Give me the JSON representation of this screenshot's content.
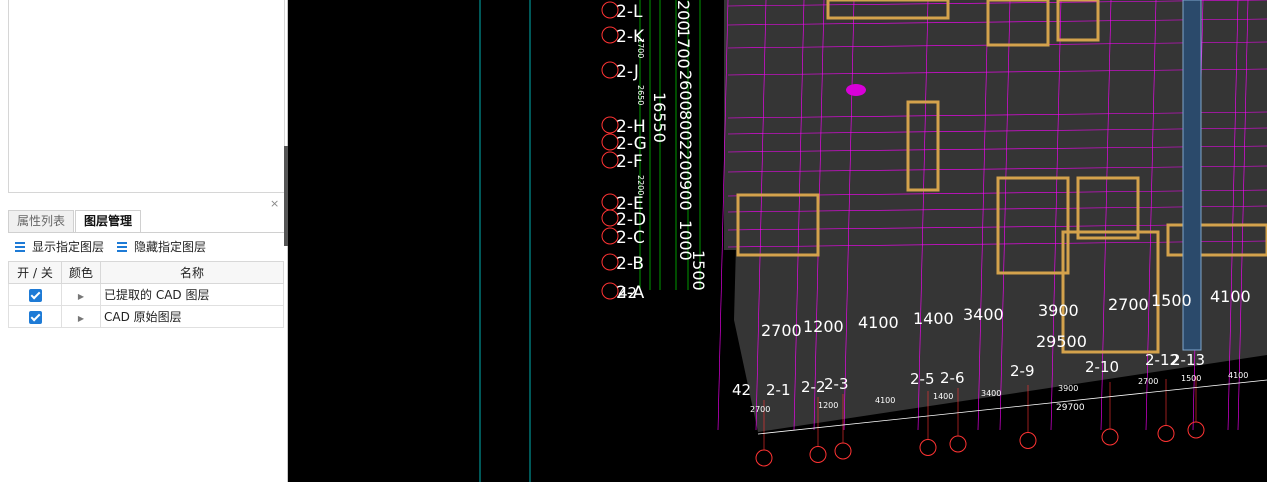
{
  "panel": {
    "close": "×",
    "tabs": [
      {
        "label": "属性列表",
        "active": false
      },
      {
        "label": "图层管理",
        "active": true
      }
    ],
    "toolbar": {
      "show_layer": "显示指定图层",
      "hide_layer": "隐藏指定图层"
    },
    "table": {
      "headers": [
        "开 / 关",
        "颜色",
        "名称"
      ],
      "rows": [
        {
          "checked": true,
          "name": "已提取的 CAD 图层"
        },
        {
          "checked": true,
          "name": "CAD 原始图层"
        }
      ]
    }
  },
  "drawing": {
    "axes_left": [
      "2-L",
      "2-K",
      "2-J",
      "2-H",
      "2-G",
      "2-F",
      "2-E",
      "2-D",
      "2-C",
      "2-B",
      "2-A"
    ],
    "axis_prefix": "42",
    "left_dims_big": [
      "200",
      "1700",
      "2600",
      "800",
      "2200",
      "900",
      "1000",
      "1500"
    ],
    "left_dim_total": "16550",
    "left_dims_small": [
      "1700",
      "2650",
      "2200"
    ],
    "dims_top_row": [
      "2700",
      "1200",
      "4100",
      "1400",
      "3400",
      "3900",
      "2700",
      "1500",
      "4100"
    ],
    "dim_total_mid": "29500",
    "axes_bottom": [
      "2-1",
      "2-2",
      "2-3",
      "2-5",
      "2-6",
      "2-9",
      "2-10",
      "2-12",
      "2-13"
    ],
    "dims_bottom_small": [
      "2700",
      "1200",
      "4100",
      "1400",
      "3400",
      "3900",
      "2700",
      "1500",
      "4100"
    ],
    "dim_total_bottom": "29700",
    "colors": {
      "grid": "#ff00ff",
      "wall": "#d4a24c",
      "dim": "#00c000",
      "bubble": "#ff3333",
      "text": "#ffffff",
      "cyan": "#00b0b0"
    }
  }
}
